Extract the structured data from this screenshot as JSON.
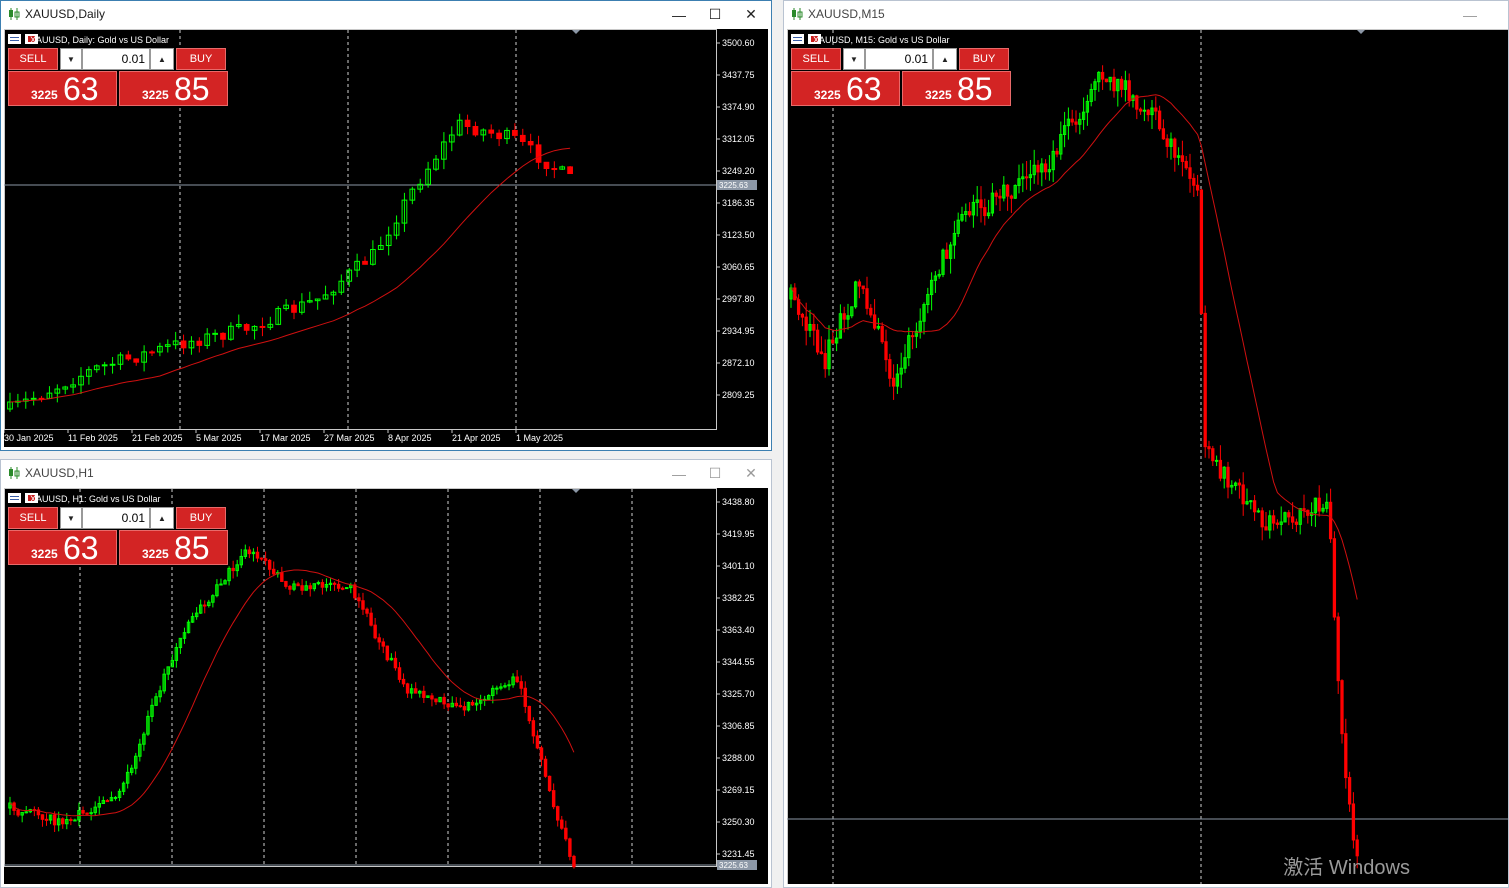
{
  "windows": {
    "daily": {
      "title": "XAUUSD,Daily",
      "description": "XAUUSD, Daily:  Gold vs US Dollar",
      "yTicks": [
        "3500.60",
        "3437.75",
        "3374.90",
        "3312.05",
        "3249.20",
        "3186.35",
        "3123.50",
        "3060.65",
        "2997.80",
        "2934.95",
        "2872.10",
        "2809.25"
      ],
      "xTicks": [
        "30 Jan 2025",
        "11 Feb 2025",
        "21 Feb 2025",
        "5 Mar 2025",
        "17 Mar 2025",
        "27 Mar 2025",
        "8 Apr 2025",
        "21 Apr 2025",
        "1 May 2025"
      ],
      "currentPriceLabel": "3225.63"
    },
    "h1": {
      "title": "XAUUSD,H1",
      "description": "XAUUSD, H1:  Gold vs US Dollar",
      "yTicks": [
        "3438.80",
        "3419.95",
        "3401.10",
        "3382.25",
        "3363.40",
        "3344.55",
        "3325.70",
        "3306.85",
        "3288.00",
        "3269.15",
        "3250.30",
        "3231.45"
      ],
      "currentPriceLabel": "3225.63"
    },
    "m15": {
      "title": "XAUUSD,M15",
      "description": "XAUUSD, M15:  Gold vs US Dollar"
    }
  },
  "trade_panel": {
    "sell_label": "SELL",
    "buy_label": "BUY",
    "lot_value": "0.01",
    "bid_prefix": "3225",
    "bid_big": "63",
    "ask_prefix": "3225",
    "ask_big": "85"
  },
  "watermark": "激活 Windows",
  "colors": {
    "bull": "#00ff00",
    "bear": "#ff0000",
    "ma": "#d01010",
    "background": "#000000",
    "panel_red": "#d32424"
  },
  "icons": {
    "window": "candlestick-icon",
    "minimize": "minimize-icon",
    "maximize": "maximize-icon",
    "close": "close-icon"
  }
}
